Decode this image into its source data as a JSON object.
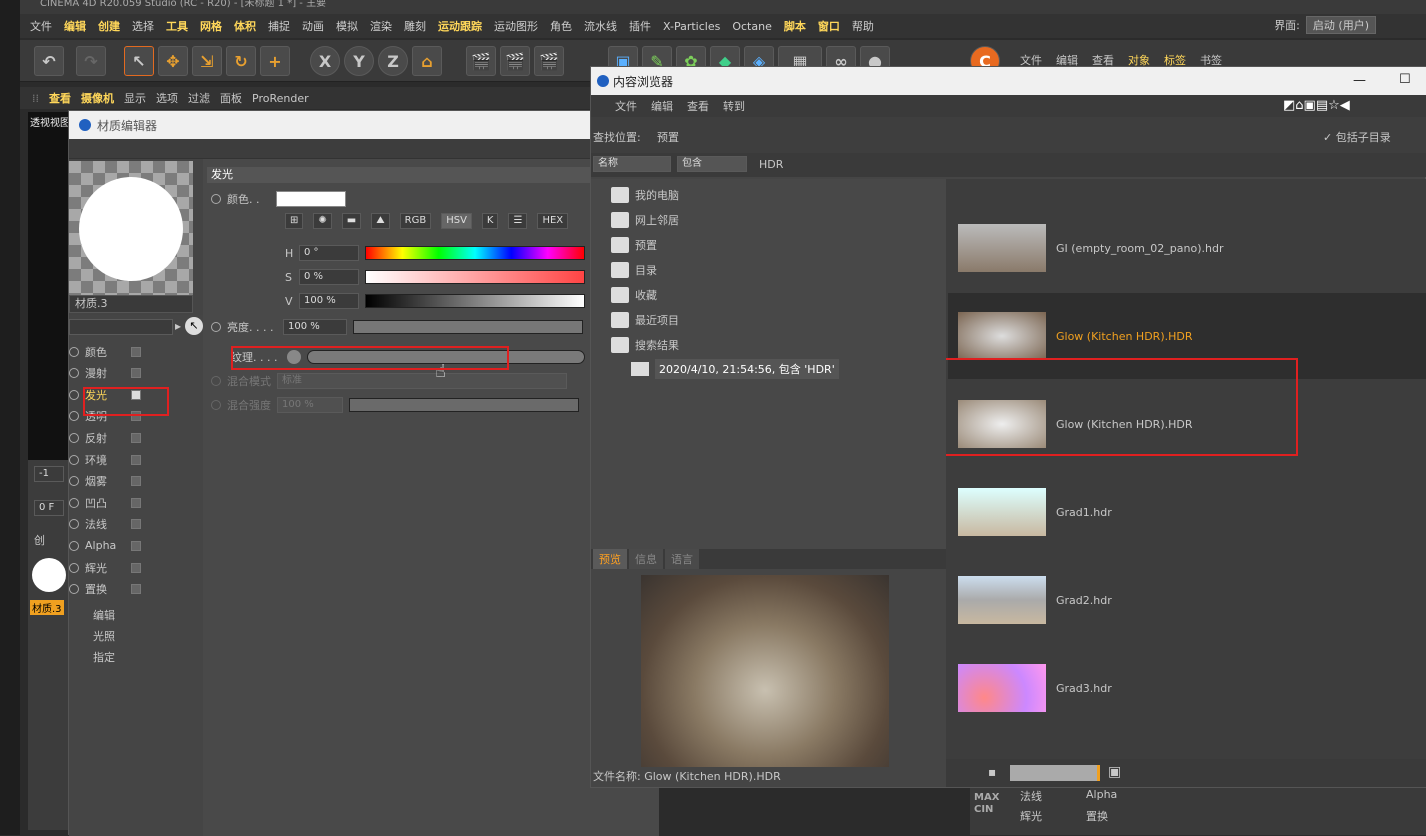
{
  "app": {
    "title_bar": "CINEMA 4D R20.059 Studio (RC - R20) - [未标题 1 *] - 主要",
    "menu": [
      "文件",
      "编辑",
      "创建",
      "选择",
      "工具",
      "网格",
      "体积",
      "捕捉",
      "动画",
      "模拟",
      "渲染",
      "雕刻",
      "运动跟踪",
      "运动图形",
      "角色",
      "流水线",
      "插件",
      "X-Particles",
      "Octane",
      "脚本",
      "窗口",
      "帮助"
    ],
    "menu_highlight": [
      "编辑",
      "创建",
      "工具",
      "网格",
      "体积",
      "运动跟踪",
      "脚本",
      "窗口"
    ],
    "layout_label": "界面:",
    "layout_value": "启动 (用户)",
    "right_menu": [
      "文件",
      "编辑",
      "查看",
      "对象",
      "标签",
      "书签"
    ]
  },
  "viewport": {
    "menu": [
      "查看",
      "摄像机",
      "显示",
      "选项",
      "过滤",
      "面板",
      "ProRender"
    ],
    "label": "透视视图",
    "frame_label": "0 F",
    "frame_value": "-1",
    "creator_label": "创",
    "material_label": "材质.3"
  },
  "material_editor": {
    "title": "材质编辑器",
    "material_name": "材质.3",
    "channels": [
      {
        "label": "颜色",
        "checked": false
      },
      {
        "label": "漫射",
        "checked": false
      },
      {
        "label": "发光",
        "checked": true
      },
      {
        "label": "透明",
        "checked": false
      },
      {
        "label": "反射",
        "checked": false
      },
      {
        "label": "环境",
        "checked": false
      },
      {
        "label": "烟雾",
        "checked": false
      },
      {
        "label": "凹凸",
        "checked": false
      },
      {
        "label": "法线",
        "checked": false
      },
      {
        "label": "Alpha",
        "checked": false
      },
      {
        "label": "辉光",
        "checked": false
      },
      {
        "label": "置换",
        "checked": false
      }
    ],
    "extra": [
      "编辑",
      "光照",
      "指定"
    ],
    "section_title": "发光",
    "color_label": "颜色. .",
    "color_value": "#ffffff",
    "mode_buttons": [
      "RGB",
      "HSV",
      "K",
      "HEX"
    ],
    "hsv": [
      {
        "k": "H",
        "v": "0 °"
      },
      {
        "k": "S",
        "v": "0 %"
      },
      {
        "k": "V",
        "v": "100 %"
      }
    ],
    "brightness_label": "亮度. . . .",
    "brightness_value": "100 %",
    "texture_label": "纹理. . . .",
    "blend_mode_label": "混合模式",
    "blend_mode_value": "标准",
    "blend_strength_label": "混合强度",
    "blend_strength_value": "100 %"
  },
  "content_browser": {
    "title": "内容浏览器",
    "menu": [
      "文件",
      "编辑",
      "查看",
      "转到"
    ],
    "location_label": "查找位置:",
    "location_value": "预置",
    "include_sub": "包括子目录",
    "filter_field": "名称",
    "filter_op": "包含",
    "search_text": "HDR",
    "tree": [
      "我的电脑",
      "网上邻居",
      "预置",
      "目录",
      "收藏",
      "最近项目",
      "搜索结果"
    ],
    "search_result": "2020/4/10, 21:54:56, 包含 'HDR'",
    "items": [
      {
        "name": "GI (empty_room_02_pano).hdr",
        "selected": false
      },
      {
        "name": "Glow (Kitchen HDR).HDR",
        "selected": true
      },
      {
        "name": "Glow (Kitchen HDR).HDR",
        "selected": false
      },
      {
        "name": "Grad1.hdr",
        "selected": false
      },
      {
        "name": "Grad2.hdr",
        "selected": false
      },
      {
        "name": "Grad3.hdr",
        "selected": false
      }
    ],
    "preview_tabs": [
      "预览",
      "信息",
      "语言"
    ],
    "filename_label": "文件名称:",
    "filename_value": "Glow (Kitchen HDR).HDR"
  },
  "bottom_right": {
    "rows": [
      [
        "法线",
        "Alpha"
      ],
      [
        "辉光",
        "置换"
      ]
    ]
  }
}
